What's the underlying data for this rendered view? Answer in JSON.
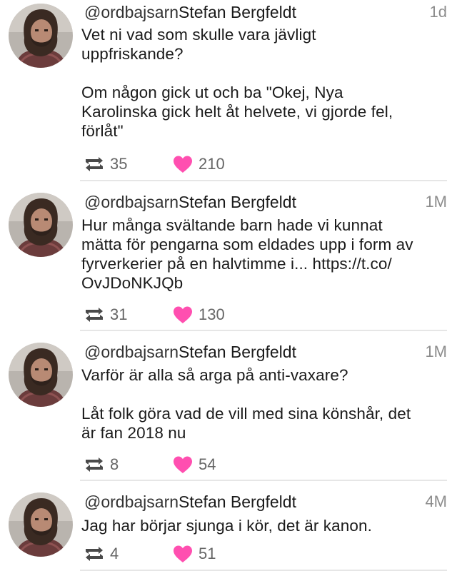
{
  "colors": {
    "like": "#ff4fb0",
    "retweet": "#4a4a4a",
    "muted": "#8c8c8c",
    "divider": "#e6e6e6"
  },
  "icons": {
    "retweet": "retweet-icon",
    "like": "heart-icon"
  },
  "tweets": [
    {
      "handle": "@ordbajsarn",
      "name": "Stefan Bergfeldt",
      "time": "1d",
      "text": "Vet ni vad som skulle vara jävligt\nuppfriskande?\n\nOm någon gick ut och ba \"Okej, Nya\nKarolinska gick helt åt helvete, vi gjorde fel,\nförlåt\"",
      "retweets": "35",
      "likes": "210"
    },
    {
      "handle": "@ordbajsarn",
      "name": "Stefan Bergfeldt",
      "time": "1M",
      "text": "Hur många svältande barn hade vi kunnat\nmätta för pengarna som eldades upp i form av\nfyrverkerier på en halvtimme i... https://t.co/\nOvJDoNKJQb",
      "retweets": "31",
      "likes": "130"
    },
    {
      "handle": "@ordbajsarn",
      "name": "Stefan Bergfeldt",
      "time": "1M",
      "text": "Varför är alla så arga på anti-vaxare?\n\nLåt folk göra vad de vill med sina könshår, det\när fan 2018 nu",
      "retweets": "8",
      "likes": "54"
    },
    {
      "handle": "@ordbajsarn",
      "name": "Stefan Bergfeldt",
      "time": "4M",
      "text": "Jag har börjar sjunga i kör, det är kanon.",
      "retweets": "4",
      "likes": "51"
    }
  ]
}
